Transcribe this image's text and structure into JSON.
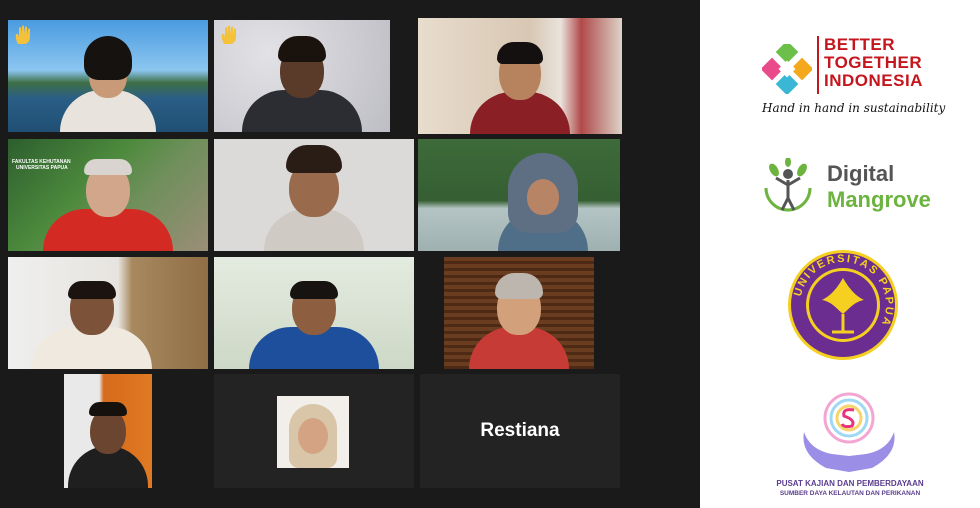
{
  "meeting": {
    "participants": [
      {
        "id": 1,
        "raised_hand": true
      },
      {
        "id": 2,
        "raised_hand": true
      },
      {
        "id": 3,
        "active_speaker": true
      },
      {
        "id": 4,
        "slide_text": {
          "title": "FAKULTAS KEHUTANAN",
          "subtitle": "UNIVERSITAS PAPUA"
        }
      },
      {
        "id": 5
      },
      {
        "id": 6
      },
      {
        "id": 7
      },
      {
        "id": 8
      },
      {
        "id": 9
      },
      {
        "id": 10
      },
      {
        "id": 11,
        "avatar_only": true
      },
      {
        "id": 12,
        "name": "Restiana",
        "video_off": true
      }
    ]
  },
  "sponsors": {
    "better_together": {
      "title": "BETTER TOGETHER INDONESIA",
      "title_line1": "BETTER",
      "title_line2": "TOGETHER",
      "title_line3": "INDONESIA",
      "tagline": "Hand in hand in sustainability"
    },
    "digital_mangrove": {
      "line1": "Digital",
      "line2": "Mangrove"
    },
    "universitas_papua": {
      "ring_text": "UNIVERSITAS PAPUA"
    },
    "pusat_kajian": {
      "line1": "PUSAT KAJIAN DAN PEMBERDAYAAN",
      "line2": "SUMBER DAYA KELAUTAN DAN PERIKANAN"
    }
  },
  "colors": {
    "active_border": "#b6e33e",
    "bt_red": "#c4161c",
    "dm_green": "#6cb33f",
    "unipa_purple": "#6b2d8f",
    "unipa_yellow": "#f5d020"
  }
}
